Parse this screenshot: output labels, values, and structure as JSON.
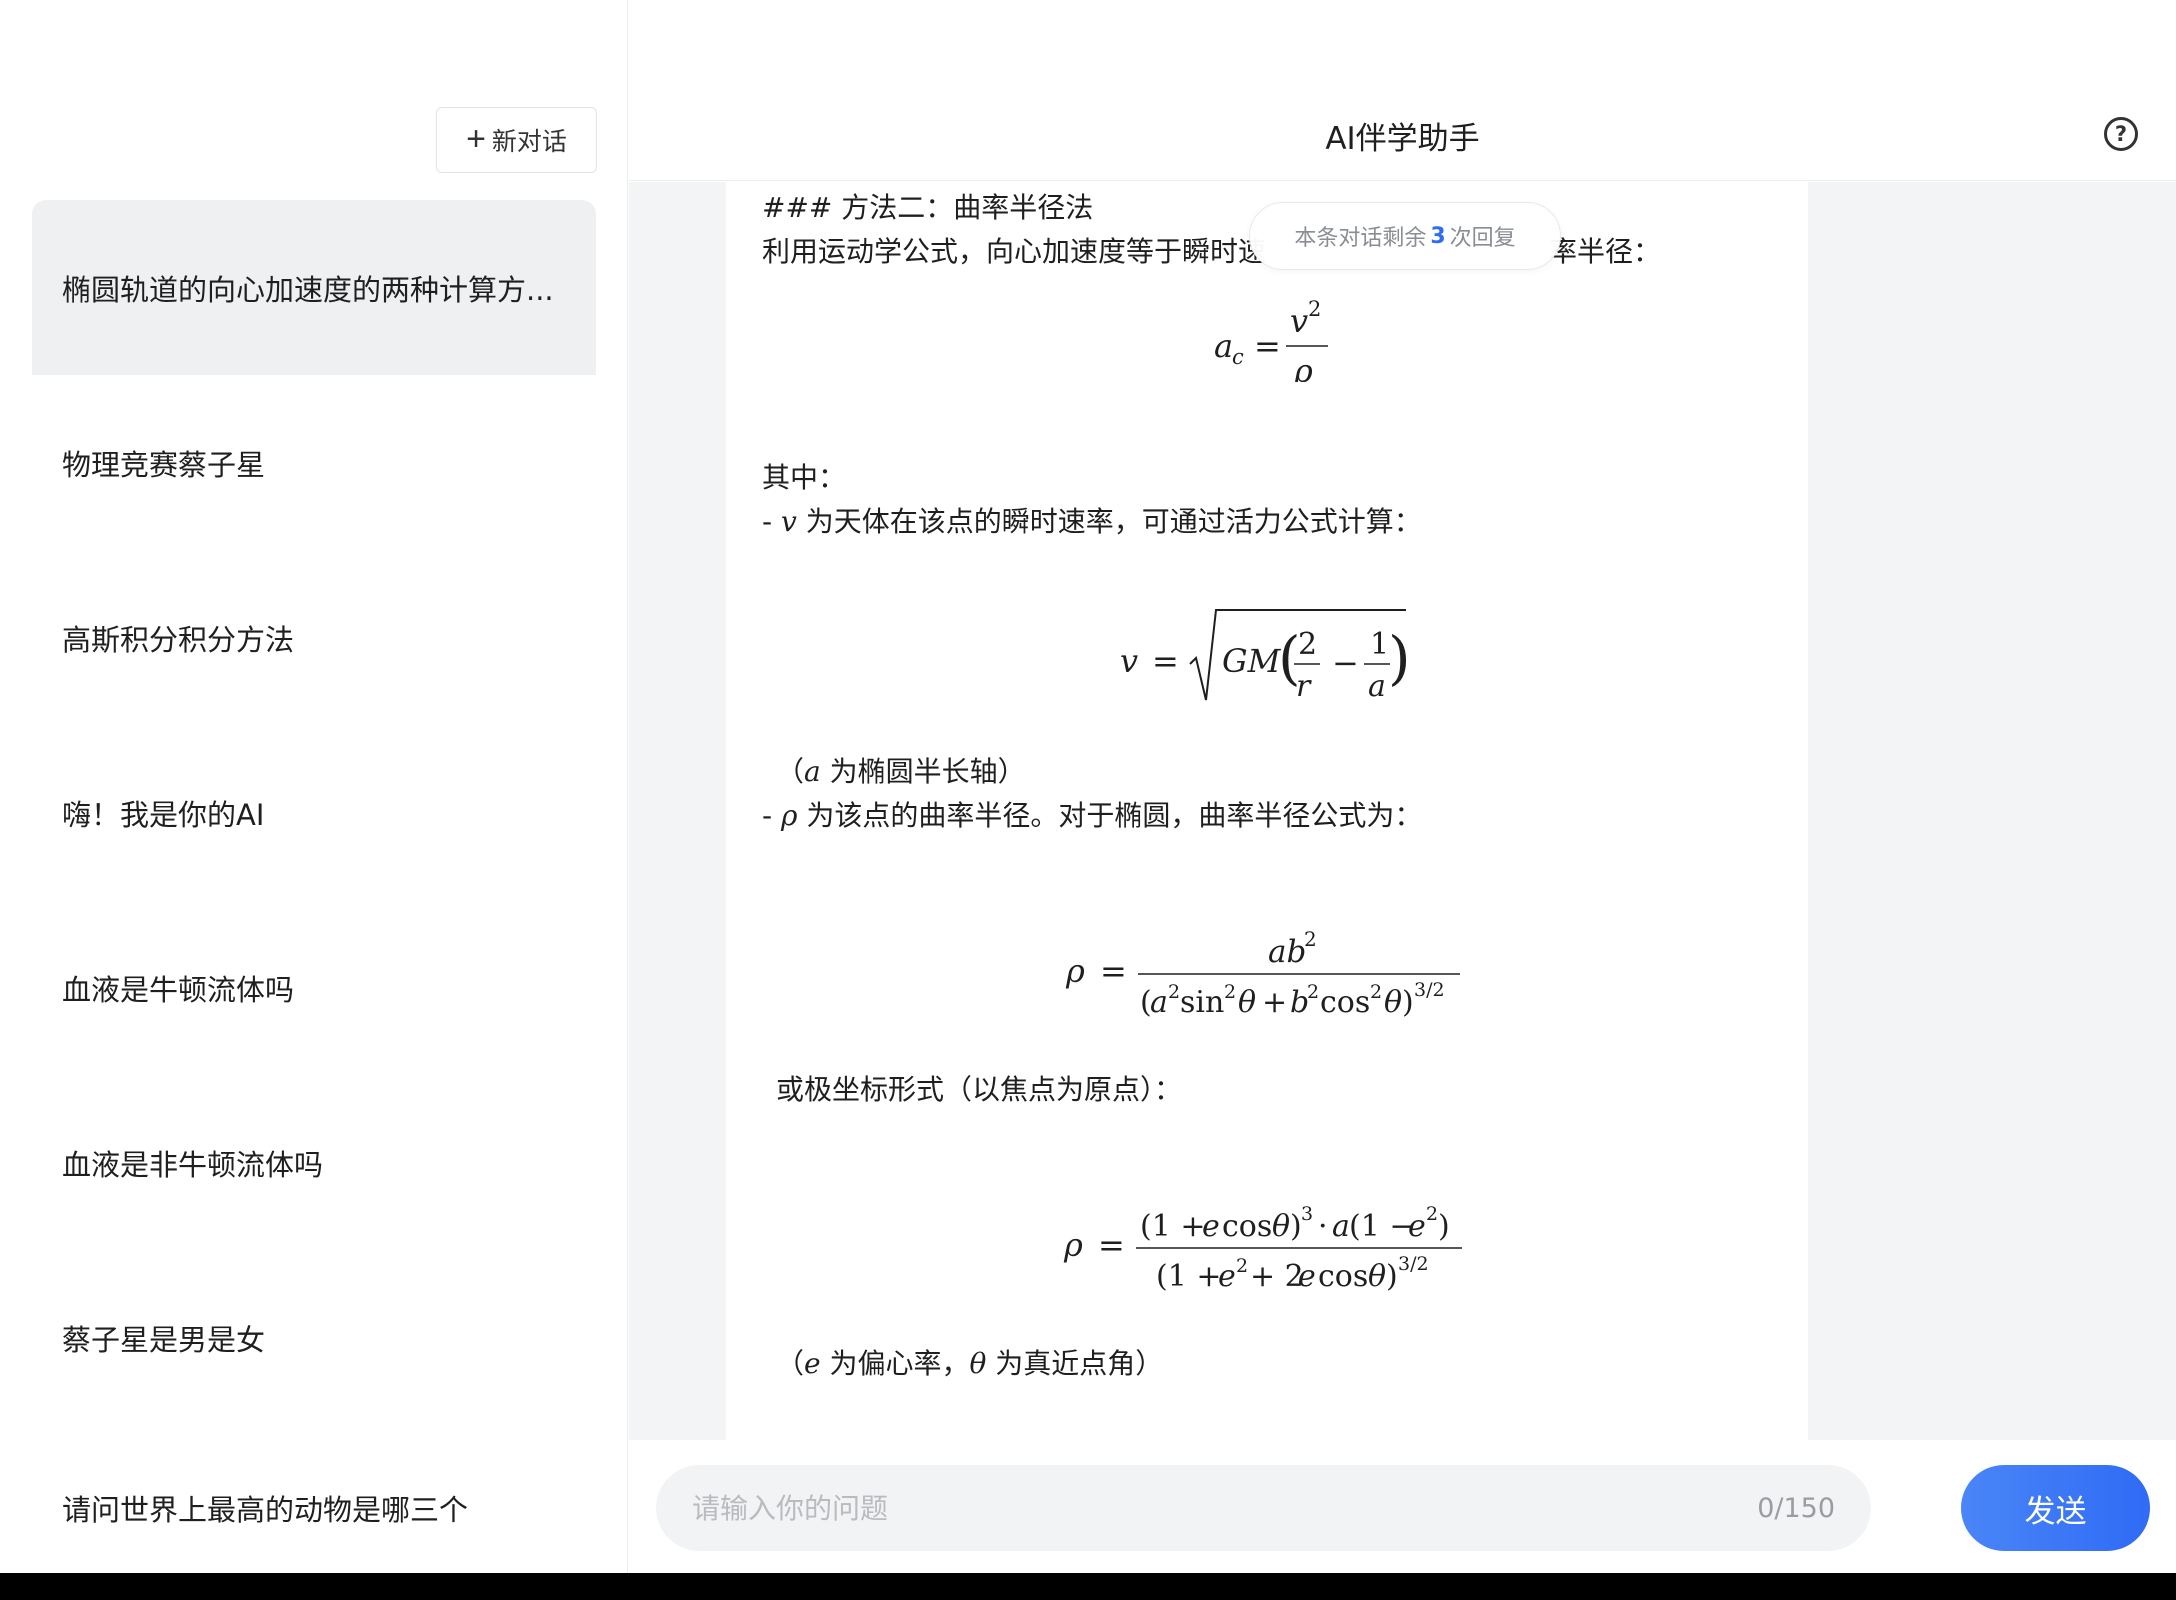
{
  "sidebar": {
    "new_chat_label": "新对话",
    "conversations": [
      "椭圆轨道的向心加速度的两种计算方...",
      "物理竞赛蔡子星",
      "高斯积分积分方法",
      "嗨！我是你的AI",
      "血液是牛顿流体吗",
      "血液是非牛顿流体吗",
      "蔡子星是男是女",
      "请问世界上最高的动物是哪三个"
    ]
  },
  "header": {
    "title": "AI伴学助手",
    "help_icon": "question-circle-icon"
  },
  "reply_notice": {
    "prefix": "本条对话剩余",
    "count": "3",
    "suffix": "次回复"
  },
  "message": {
    "heading": "### 方法二：曲率半径法",
    "intro_left": "利用运动学公式，向心加速度等于瞬时速",
    "intro_right": "率半径：",
    "where": "其中：",
    "bullet_v_dash": "- ",
    "bullet_v_var": "v",
    "bullet_v_text": " 为天体在该点的瞬时速率，可通过活力公式计算：",
    "note_a_open": "（",
    "note_a_var": "a",
    "note_a_text": " 为椭圆半长轴）",
    "bullet_rho_dash": "- ",
    "bullet_rho_var": "ρ",
    "bullet_rho_text": " 为该点的曲率半径。对于椭圆，曲率半径公式为：",
    "polar_text": "或极坐标形式（以焦点为原点）：",
    "note_e_open": "（",
    "note_e_var": "e",
    "note_e_text": " 为偏心率，",
    "note_theta_var": "θ",
    "note_theta_text": " 为真近点角）"
  },
  "input": {
    "placeholder": "请输入你的问题",
    "char_count": "0/150",
    "send_label": "发送"
  }
}
